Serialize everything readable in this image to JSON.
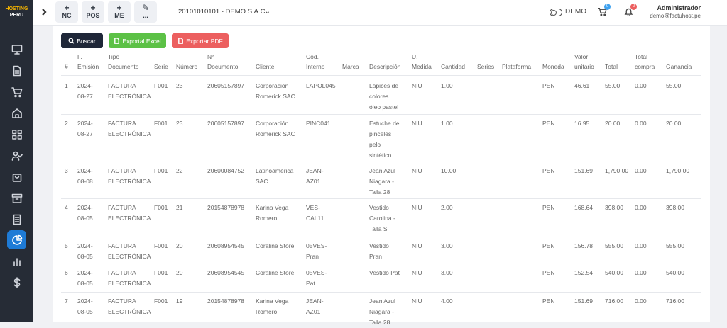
{
  "app": {
    "logo_top": "HOSTING",
    "logo_bottom": "PERU"
  },
  "sidebar": {
    "icons": [
      "monitor-icon",
      "document-icon",
      "cart-icon",
      "home-icon",
      "grid-icon",
      "users-check-icon",
      "bag-icon",
      "archive-icon",
      "receipt-icon",
      "chart-pie-icon",
      "bar-chart-icon",
      "dollar-icon"
    ],
    "active": "chart-pie-icon"
  },
  "topbar": {
    "quick_actions": [
      {
        "symbol": "+",
        "label": "NC"
      },
      {
        "symbol": "+",
        "label": "POS"
      },
      {
        "symbol": "+",
        "label": "ME"
      },
      {
        "symbol": "✎",
        "label": "..."
      }
    ],
    "company": "20101010101 - DEMO S.A.C.",
    "mode": "DEMO",
    "cart_count": "0",
    "notif_count": "2",
    "user_name": "Administrador",
    "user_email": "demo@factuhost.pe"
  },
  "toolbar": {
    "search": "Buscar",
    "excel": "Exportal Excel",
    "pdf": "Exportar PDF"
  },
  "table": {
    "headers": [
      [
        "#"
      ],
      [
        "F.",
        "Emisión"
      ],
      [
        "Tipo",
        "Documento"
      ],
      [
        "Serie"
      ],
      [
        "Número"
      ],
      [
        "N°",
        "Documento"
      ],
      [
        "Cliente"
      ],
      [
        "Cod.",
        "Interno"
      ],
      [
        "Marca"
      ],
      [
        "Descripción"
      ],
      [
        "U.",
        "Medida"
      ],
      [
        "Cantidad"
      ],
      [
        "Series"
      ],
      [
        "Plataforma"
      ],
      [
        "Moneda"
      ],
      [
        "Valor",
        "unitario"
      ],
      [
        "Total"
      ],
      [
        "Total",
        "compra"
      ],
      [
        "Ganancia"
      ]
    ],
    "rows": [
      [
        [
          "1"
        ],
        [
          "2024-",
          "08-27"
        ],
        [
          "FACTURA",
          "ELECTRÓNICA"
        ],
        [
          "F001"
        ],
        [
          "23"
        ],
        [
          "20605157897"
        ],
        [
          "Corporación",
          "Romerick SAC"
        ],
        [
          "LAPOL045"
        ],
        [
          ""
        ],
        [
          "Lápices de",
          "colores",
          "óleo pastel"
        ],
        [
          "NIU"
        ],
        [
          "1.00"
        ],
        [
          ""
        ],
        [
          ""
        ],
        [
          "PEN"
        ],
        [
          "46.61"
        ],
        [
          "55.00"
        ],
        [
          "0.00"
        ],
        [
          "55.00"
        ]
      ],
      [
        [
          "2"
        ],
        [
          "2024-",
          "08-27"
        ],
        [
          "FACTURA",
          "ELECTRÓNICA"
        ],
        [
          "F001"
        ],
        [
          "23"
        ],
        [
          "20605157897"
        ],
        [
          "Corporación",
          "Romerick SAC"
        ],
        [
          "PINC041"
        ],
        [
          ""
        ],
        [
          "Estuche de",
          "pinceles",
          "pelo",
          "sintético"
        ],
        [
          "NIU"
        ],
        [
          "1.00"
        ],
        [
          ""
        ],
        [
          ""
        ],
        [
          "PEN"
        ],
        [
          "16.95"
        ],
        [
          "20.00"
        ],
        [
          "0.00"
        ],
        [
          "20.00"
        ]
      ],
      [
        [
          "3"
        ],
        [
          "2024-",
          "08-08"
        ],
        [
          "FACTURA",
          "ELECTRÓNICA"
        ],
        [
          "F001"
        ],
        [
          "22"
        ],
        [
          "20600084752"
        ],
        [
          "Latinoamérica",
          "SAC"
        ],
        [
          "JEAN-",
          "AZ01"
        ],
        [
          ""
        ],
        [
          "Jean Azul",
          "Niagara -",
          "Talla 28"
        ],
        [
          "NIU"
        ],
        [
          "10.00"
        ],
        [
          ""
        ],
        [
          ""
        ],
        [
          "PEN"
        ],
        [
          "151.69"
        ],
        [
          "1,790.00"
        ],
        [
          "0.00"
        ],
        [
          "1,790.00"
        ]
      ],
      [
        [
          "4"
        ],
        [
          "2024-",
          "08-05"
        ],
        [
          "FACTURA",
          "ELECTRÓNICA"
        ],
        [
          "F001"
        ],
        [
          "21"
        ],
        [
          "20154878978"
        ],
        [
          "Karina Vega",
          "Romero"
        ],
        [
          "VES-",
          "CAL11"
        ],
        [
          ""
        ],
        [
          "Vestido",
          "Carolina -",
          "Talla S"
        ],
        [
          "NIU"
        ],
        [
          "2.00"
        ],
        [
          ""
        ],
        [
          ""
        ],
        [
          "PEN"
        ],
        [
          "168.64"
        ],
        [
          "398.00"
        ],
        [
          "0.00"
        ],
        [
          "398.00"
        ]
      ],
      [
        [
          "5"
        ],
        [
          "2024-",
          "08-05"
        ],
        [
          "FACTURA",
          "ELECTRÓNICA"
        ],
        [
          "F001"
        ],
        [
          "20"
        ],
        [
          "20608954545"
        ],
        [
          "Coraline Store"
        ],
        [
          "05VES-",
          "Pran"
        ],
        [
          ""
        ],
        [
          "Vestido",
          "Pran"
        ],
        [
          "NIU"
        ],
        [
          "3.00"
        ],
        [
          ""
        ],
        [
          ""
        ],
        [
          "PEN"
        ],
        [
          "156.78"
        ],
        [
          "555.00"
        ],
        [
          "0.00"
        ],
        [
          "555.00"
        ]
      ],
      [
        [
          "6"
        ],
        [
          "2024-",
          "08-05"
        ],
        [
          "FACTURA",
          "ELECTRÓNICA"
        ],
        [
          "F001"
        ],
        [
          "20"
        ],
        [
          "20608954545"
        ],
        [
          "Coraline Store"
        ],
        [
          "05VES-",
          "Pat"
        ],
        [
          ""
        ],
        [
          "Vestido Pat"
        ],
        [
          "NIU"
        ],
        [
          "3.00"
        ],
        [
          ""
        ],
        [
          ""
        ],
        [
          "PEN"
        ],
        [
          "152.54"
        ],
        [
          "540.00"
        ],
        [
          "0.00"
        ],
        [
          "540.00"
        ]
      ],
      [
        [
          "7"
        ],
        [
          "2024-",
          "08-05"
        ],
        [
          "FACTURA",
          "ELECTRÓNICA"
        ],
        [
          "F001"
        ],
        [
          "19"
        ],
        [
          "20154878978"
        ],
        [
          "Karina Vega",
          "Romero"
        ],
        [
          "JEAN-",
          "AZ01"
        ],
        [
          ""
        ],
        [
          "Jean Azul",
          "Niagara -",
          "Talla 28"
        ],
        [
          "NIU"
        ],
        [
          "4.00"
        ],
        [
          ""
        ],
        [
          ""
        ],
        [
          "PEN"
        ],
        [
          "151.69"
        ],
        [
          "716.00"
        ],
        [
          "0.00"
        ],
        [
          "716.00"
        ]
      ]
    ]
  }
}
